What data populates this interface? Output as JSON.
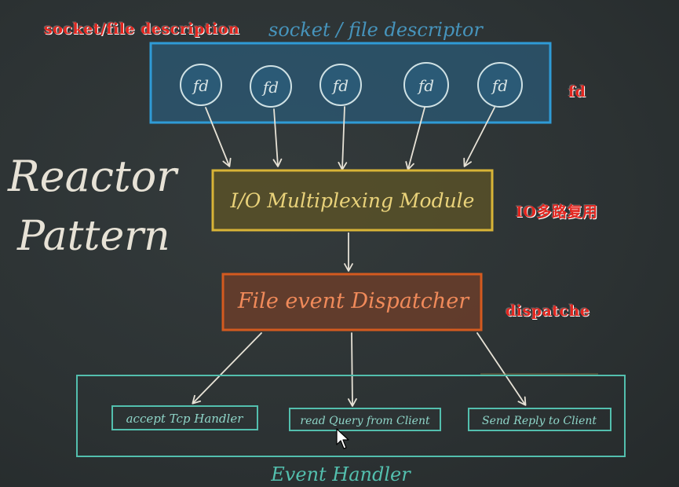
{
  "title": {
    "line1": "Reactor",
    "line2": "Pattern"
  },
  "fd_group": {
    "heading": "socket / file descriptor",
    "items": [
      "fd",
      "fd",
      "fd",
      "fd",
      "fd"
    ]
  },
  "multiplexer": {
    "label": "I/O Multiplexing Module"
  },
  "dispatcher": {
    "label": "File event Dispatcher"
  },
  "handlers": {
    "heading": "Event Handler",
    "items": [
      "accept Tcp Handler",
      "read Query from Client",
      "Send Reply to Client"
    ]
  },
  "annotations": {
    "top": "socket/file description",
    "fd": "fd",
    "io": "IO多路复用",
    "dispatch": "dispatche"
  },
  "colors": {
    "background": "#2b3132",
    "chalk": "#e7e2d6",
    "fd_box": "#2f9bd6",
    "fd_box_fill": "#2b5a76",
    "io_box": "#d8b437",
    "io_box_fill": "#5b5227",
    "dispatch_box": "#d45a1f",
    "dispatch_box_fill": "#6a3d2a",
    "handler_box": "#53bfae",
    "annotation": "#e3261f"
  },
  "icons": [
    "mouse-cursor-icon"
  ]
}
